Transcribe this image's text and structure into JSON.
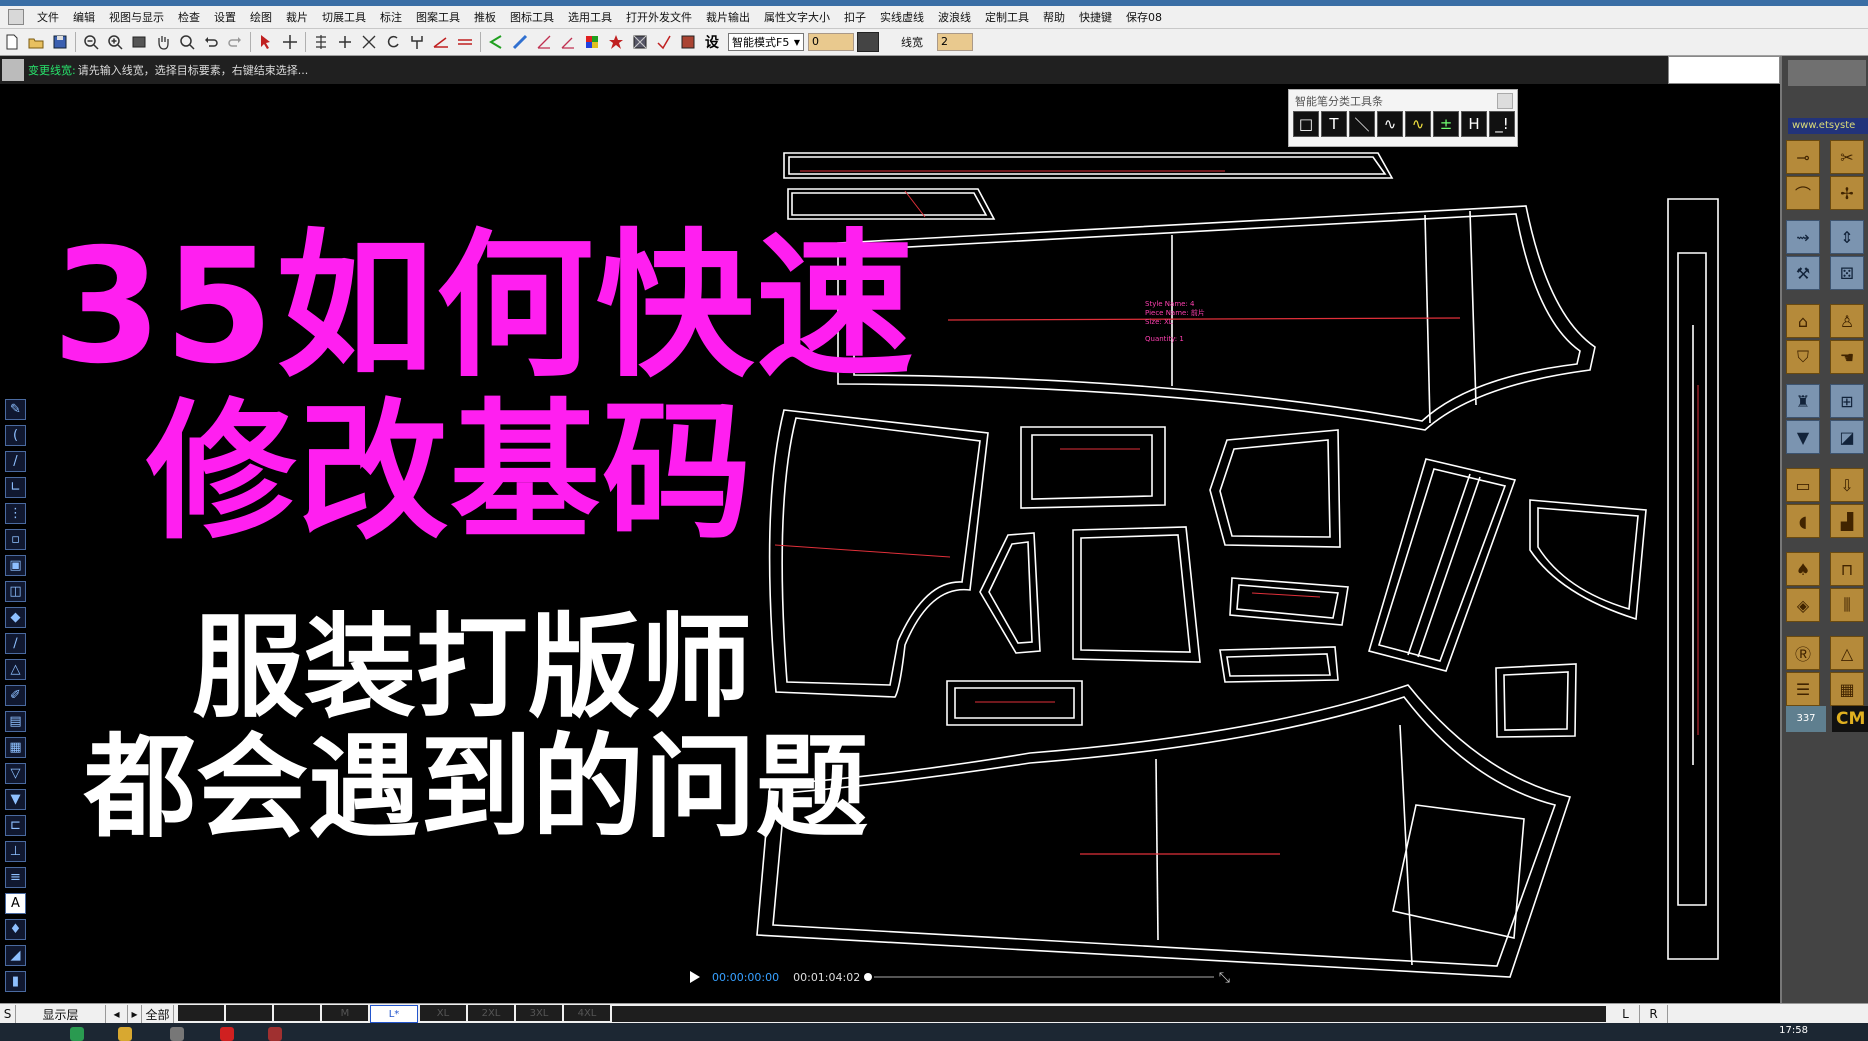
{
  "window": {
    "title": ""
  },
  "menu": [
    "文件",
    "编辑",
    "视图与显示",
    "检查",
    "设置",
    "绘图",
    "裁片",
    "切展工具",
    "标注",
    "图案工具",
    "推板",
    "图标工具",
    "选用工具",
    "打开外发文件",
    "裁片输出",
    "属性文字大小",
    "扣子",
    "实线虚线",
    "波浪线",
    "定制工具",
    "帮助",
    "快捷键",
    "保存08"
  ],
  "toolbar": {
    "mode_label": "智能模式F5",
    "field_1": "0",
    "line_width_label": "线宽",
    "line_width_value": "2",
    "set_label": "设"
  },
  "status": {
    "command": "变更线宽:",
    "prompt": "请先输入线宽，选择目标要素，右键结束选择..."
  },
  "smart_toolbox": {
    "title": "智能笔分类工具条",
    "buttons": [
      "□",
      "T",
      "＼",
      "∿",
      "∿",
      "±",
      "H",
      "_!"
    ]
  },
  "overlay": {
    "line1": "35如何快速",
    "line2": "修改基码",
    "line3": "服装打版师",
    "line4": "都会遇到的问题"
  },
  "player": {
    "current_time": "00:00:00:00",
    "total_time": "00:01:04:02"
  },
  "right_panel": {
    "url": "www.etsyste",
    "counter": "337",
    "brand": "CM"
  },
  "bottom": {
    "s_label": "S",
    "layer_label": "显示层",
    "all_label": "全部",
    "sizes": [
      "",
      "",
      "",
      "M",
      "L*",
      "XL",
      "2XL",
      "3XL",
      "4XL"
    ],
    "active_size": "L*",
    "l_label": "L",
    "r_label": "R"
  },
  "taskbar": {
    "clock": "17:58"
  },
  "pattern_labels": {
    "style": "Style Name: 4",
    "piece": "Piece Name: 前片",
    "size": "Size: XL",
    "quantity": "Quantity: 1"
  },
  "colors": {
    "overlay_magenta": "#ff1ff0",
    "overlay_white": "#ffffff",
    "grainline": "#e0303a",
    "pattern_outline": "#ffffff",
    "command_green": "#27e36b"
  }
}
